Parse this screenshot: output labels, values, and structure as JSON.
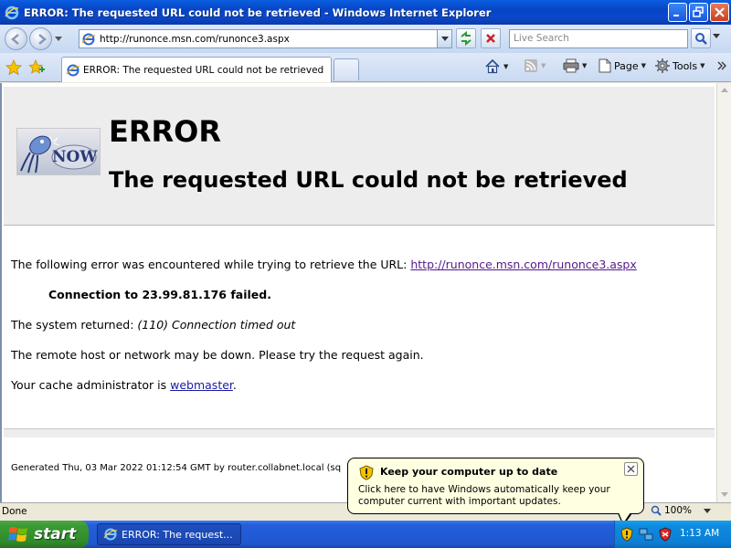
{
  "window": {
    "title": "ERROR: The requested URL could not be retrieved - Windows Internet Explorer"
  },
  "address_bar": {
    "url": "http://runonce.msn.com/runonce3.aspx",
    "search_placeholder": "Live Search"
  },
  "tabs": [
    {
      "label": "ERROR: The requested URL could not be retrieved"
    }
  ],
  "command_bar": {
    "page_label": "Page",
    "tools_label": "Tools"
  },
  "page": {
    "heading": "ERROR",
    "subheading": "The requested URL could not be retrieved",
    "intro_text": "The following error was encountered while trying to retrieve the URL: ",
    "intro_link": "http://runonce.msn.com/runonce3.aspx",
    "connection_error": "Connection to 23.99.81.176 failed.",
    "system_returned_label": "The system returned: ",
    "system_returned_value": "(110) Connection timed out",
    "remote_host_text": "The remote host or network may be down. Please try the request again.",
    "admin_text": "Your cache administrator is ",
    "admin_link": "webmaster",
    "admin_suffix": ".",
    "footer": "Generated Thu, 03 Mar 2022 01:12:54 GMT by router.collabnet.local (sq"
  },
  "status_bar": {
    "status": "Done",
    "zoom": "100%"
  },
  "balloon": {
    "title": "Keep your computer up to date",
    "body": "Click here to have Windows automatically keep your computer current with important updates."
  },
  "taskbar": {
    "start_label": "start",
    "task_label": "ERROR: The request...",
    "clock": "1:13 AM"
  },
  "colors": {
    "titlebar": "#0a48cc",
    "visited_link": "#551a8b",
    "link": "#1a1aa6",
    "balloon_bg": "#ffffe1",
    "start_green": "#3a9a33"
  }
}
